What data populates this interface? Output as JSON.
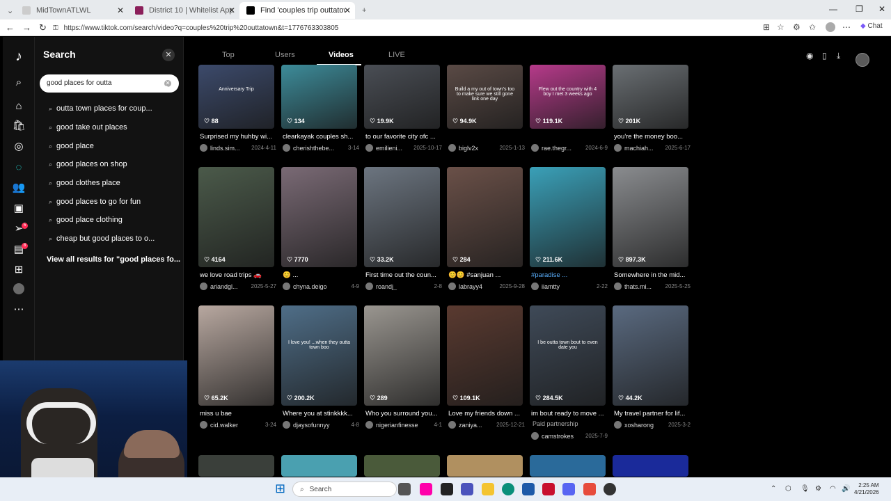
{
  "browser": {
    "tabs": [
      {
        "title": "MidTownATLWL",
        "active": false
      },
      {
        "title": "District 10 | Whitelist Application",
        "active": false
      },
      {
        "title": "Find 'couples trip outtatown' on T",
        "active": true
      }
    ],
    "url": "https://www.tiktok.com/search/video?q=couples%20trip%20outtatown&t=1776763303805",
    "chat_label": "Chat"
  },
  "search_panel": {
    "title": "Search",
    "input_value": "good places for outta",
    "suggestions": [
      "outta town places for coup...",
      "good take out places",
      "good place",
      "good places on shop",
      "good clothes place",
      "good places to go for fun",
      "good place clothing",
      "cheap but good places to o..."
    ],
    "view_all": "View all results for \"good places fo..."
  },
  "rail": {
    "badges": [
      "5",
      "8"
    ]
  },
  "page_tabs": [
    "Top",
    "Users",
    "Videos",
    "LIVE"
  ],
  "videos": [
    {
      "likes": "88",
      "caption": "Surprised my huhby wi...",
      "author": "linds.sim...",
      "date": "2024-4-11",
      "color": "#3c4a6b",
      "overlay": "Anniversary Trip"
    },
    {
      "likes": "134",
      "caption": "clearkayak couples sh...",
      "author": "cherishthebe...",
      "date": "3-14",
      "color": "#3d8c9a",
      "overlay": ""
    },
    {
      "likes": "19.9K",
      "caption": "to our favorite city ofc ...",
      "author": "emilieni...",
      "date": "2025-10-17",
      "color": "#4a4e55",
      "overlay": ""
    },
    {
      "likes": "94.9K",
      "caption": "",
      "author": "biglv2x",
      "date": "2025-1-13",
      "color": "#5a4a45",
      "overlay": "Build a my out of town's too to make sure we still gone link one day"
    },
    {
      "likes": "119.1K",
      "caption": "",
      "author": "rae.thegr...",
      "date": "2024-6-9",
      "color": "#b63a8a",
      "overlay": "Flew out the country with 4 boy I met 3 weeks ago"
    },
    {
      "likes": "201K",
      "caption": "you're the money boo...",
      "author": "machiah...",
      "date": "2025-6-17",
      "color": "#6a6f73",
      "overlay": ""
    },
    {
      "likes": "4164",
      "caption": "we love road trips 🚗",
      "author": "ariandgl...",
      "date": "2025-5-27",
      "color": "#4b5a4a",
      "overlay": ""
    },
    {
      "likes": "7770",
      "caption": "😊 ...",
      "author": "chyna.deigo",
      "date": "4-9",
      "color": "#7a6a75",
      "overlay": ""
    },
    {
      "likes": "33.2K",
      "caption": "First time out the coun...",
      "author": "roandj_",
      "date": "2-8",
      "color": "#6c7580",
      "overlay": ""
    },
    {
      "likes": "284",
      "caption": "😊😊 #sanjuan ...",
      "author": "labrayy4",
      "date": "2025-9-28",
      "color": "#6a5048",
      "overlay": ""
    },
    {
      "likes": "211.6K",
      "caption": "#paradise ...",
      "author": "iiamtty",
      "date": "2-22",
      "color": "#3aa0b8",
      "overlay": ""
    },
    {
      "likes": "897.3K",
      "caption": "Somewhere in the mid...",
      "author": "thats.mi...",
      "date": "2025-5-25",
      "color": "#8a8c8f",
      "overlay": ""
    },
    {
      "likes": "65.2K",
      "caption": "miss u bae",
      "author": "cid.walker",
      "date": "3-24",
      "color": "#b8a8a0",
      "overlay": ""
    },
    {
      "likes": "200.2K",
      "caption": "Where you at stinkkkk...",
      "author": "djaysofunnyy",
      "date": "4-8",
      "color": "#4f6e88",
      "overlay": "I love you! ...when they outta town boo"
    },
    {
      "likes": "289",
      "caption": "Who you surround you...",
      "author": "nigerianfinesse",
      "date": "4-1",
      "color": "#9a9690",
      "overlay": ""
    },
    {
      "likes": "109.1K",
      "caption": "Love my friends down ...",
      "author": "zaniya...",
      "date": "2025-12-21",
      "color": "#5a3a30",
      "overlay": ""
    },
    {
      "likes": "284.5K",
      "caption": "im bout ready to move ...",
      "author": "camstrokes",
      "date": "2025-7-9",
      "color": "#3f4a58",
      "overlay": "I be outta town bout to even date you"
    },
    {
      "likes": "44.2K",
      "caption": "My travel partner for lif...",
      "author": "xosharong",
      "date": "2025-3-2",
      "color": "#5a6a80",
      "overlay": ""
    }
  ],
  "paid_partnership": "Paid partnership",
  "taskbar": {
    "search_label": "Search",
    "time": "2:25 AM",
    "date": "4/21/2026"
  }
}
